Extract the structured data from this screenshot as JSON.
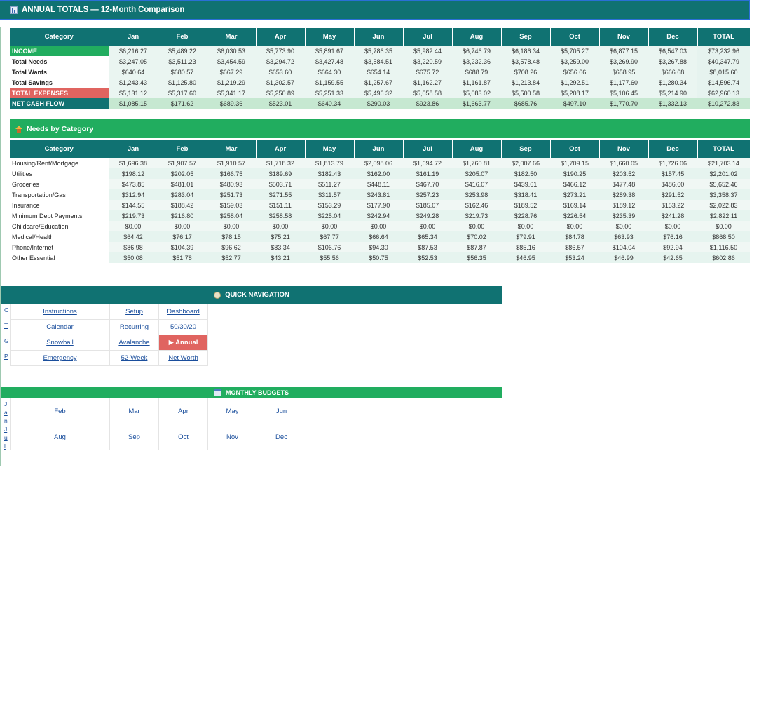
{
  "header": {
    "title": "ANNUAL TOTALS — 12-Month Comparison"
  },
  "months": [
    "Jan",
    "Feb",
    "Mar",
    "Apr",
    "May",
    "Jun",
    "Jul",
    "Aug",
    "Sep",
    "Oct",
    "Nov",
    "Dec"
  ],
  "summary": {
    "category_header": "Category",
    "total_header": "TOTAL",
    "rows": [
      {
        "label": "INCOME",
        "values": [
          "$6,216.27",
          "$5,489.22",
          "$6,030.53",
          "$5,773.90",
          "$5,891.67",
          "$5,786.35",
          "$5,982.44",
          "$6,746.79",
          "$6,186.34",
          "$5,705.27",
          "$6,877.15",
          "$6,547.03"
        ],
        "total": "$73,232.96"
      },
      {
        "label": "Total Needs",
        "values": [
          "$3,247.05",
          "$3,511.23",
          "$3,454.59",
          "$3,294.72",
          "$3,427.48",
          "$3,584.51",
          "$3,220.59",
          "$3,232.36",
          "$3,578.48",
          "$3,259.00",
          "$3,269.90",
          "$3,267.88"
        ],
        "total": "$40,347.79"
      },
      {
        "label": "Total Wants",
        "values": [
          "$640.64",
          "$680.57",
          "$667.29",
          "$653.60",
          "$664.30",
          "$654.14",
          "$675.72",
          "$688.79",
          "$708.26",
          "$656.66",
          "$658.95",
          "$666.68"
        ],
        "total": "$8,015.60"
      },
      {
        "label": "Total Savings",
        "values": [
          "$1,243.43",
          "$1,125.80",
          "$1,219.29",
          "$1,302.57",
          "$1,159.55",
          "$1,257.67",
          "$1,162.27",
          "$1,161.87",
          "$1,213.84",
          "$1,292.51",
          "$1,177.60",
          "$1,280.34"
        ],
        "total": "$14,596.74"
      },
      {
        "label": "TOTAL EXPENSES",
        "values": [
          "$5,131.12",
          "$5,317.60",
          "$5,341.17",
          "$5,250.89",
          "$5,251.33",
          "$5,496.32",
          "$5,058.58",
          "$5,083.02",
          "$5,500.58",
          "$5,208.17",
          "$5,106.45",
          "$5,214.90"
        ],
        "total": "$62,960.13"
      },
      {
        "label": "NET CASH FLOW",
        "values": [
          "$1,085.15",
          "$171.62",
          "$689.36",
          "$523.01",
          "$640.34",
          "$290.03",
          "$923.86",
          "$1,663.77",
          "$685.76",
          "$497.10",
          "$1,770.70",
          "$1,332.13"
        ],
        "total": "$10,272.83"
      }
    ]
  },
  "needs": {
    "section_title": "Needs by Category",
    "category_header": "Category",
    "total_header": "TOTAL",
    "rows": [
      {
        "label": "Housing/Rent/Mortgage",
        "values": [
          "$1,696.38",
          "$1,907.57",
          "$1,910.57",
          "$1,718.32",
          "$1,813.79",
          "$2,098.06",
          "$1,694.72",
          "$1,760.81",
          "$2,007.66",
          "$1,709.15",
          "$1,660.05",
          "$1,726.06"
        ],
        "total": "$21,703.14"
      },
      {
        "label": "Utilities",
        "values": [
          "$198.12",
          "$202.05",
          "$166.75",
          "$189.69",
          "$182.43",
          "$162.00",
          "$161.19",
          "$205.07",
          "$182.50",
          "$190.25",
          "$203.52",
          "$157.45"
        ],
        "total": "$2,201.02"
      },
      {
        "label": "Groceries",
        "values": [
          "$473.85",
          "$481.01",
          "$480.93",
          "$503.71",
          "$511.27",
          "$448.11",
          "$467.70",
          "$416.07",
          "$439.61",
          "$466.12",
          "$477.48",
          "$486.60"
        ],
        "total": "$5,652.46"
      },
      {
        "label": "Transportation/Gas",
        "values": [
          "$312.94",
          "$283.04",
          "$251.73",
          "$271.55",
          "$311.57",
          "$243.81",
          "$257.23",
          "$253.98",
          "$318.41",
          "$273.21",
          "$289.38",
          "$291.52"
        ],
        "total": "$3,358.37"
      },
      {
        "label": "Insurance",
        "values": [
          "$144.55",
          "$188.42",
          "$159.03",
          "$151.11",
          "$153.29",
          "$177.90",
          "$185.07",
          "$162.46",
          "$189.52",
          "$169.14",
          "$189.12",
          "$153.22"
        ],
        "total": "$2,022.83"
      },
      {
        "label": "Minimum Debt Payments",
        "values": [
          "$219.73",
          "$216.80",
          "$258.04",
          "$258.58",
          "$225.04",
          "$242.94",
          "$249.28",
          "$219.73",
          "$228.76",
          "$226.54",
          "$235.39",
          "$241.28"
        ],
        "total": "$2,822.11"
      },
      {
        "label": "Childcare/Education",
        "values": [
          "$0.00",
          "$0.00",
          "$0.00",
          "$0.00",
          "$0.00",
          "$0.00",
          "$0.00",
          "$0.00",
          "$0.00",
          "$0.00",
          "$0.00",
          "$0.00"
        ],
        "total": "$0.00"
      },
      {
        "label": "Medical/Health",
        "values": [
          "$64.42",
          "$76.17",
          "$78.15",
          "$75.21",
          "$67.77",
          "$66.64",
          "$65.34",
          "$70.02",
          "$79.91",
          "$84.78",
          "$63.93",
          "$76.16"
        ],
        "total": "$868.50"
      },
      {
        "label": "Phone/Internet",
        "values": [
          "$86.98",
          "$104.39",
          "$96.62",
          "$83.34",
          "$106.76",
          "$94.30",
          "$87.53",
          "$87.87",
          "$85.16",
          "$86.57",
          "$104.04",
          "$92.94"
        ],
        "total": "$1,116.50"
      },
      {
        "label": "Other Essential",
        "values": [
          "$50.08",
          "$51.78",
          "$52.77",
          "$43.21",
          "$55.56",
          "$50.75",
          "$52.53",
          "$56.35",
          "$46.95",
          "$53.24",
          "$46.99",
          "$42.65"
        ],
        "total": "$602.86"
      }
    ]
  },
  "quick_nav": {
    "title": "QUICK NAVIGATION",
    "rows": [
      [
        "Instructions",
        "Setup",
        "Dashboard"
      ],
      [
        "Calendar",
        "Recurring",
        "50/30/20"
      ],
      [
        "Snowball",
        "Avalanche",
        "▶ Annual"
      ],
      [
        "Emergency",
        "52-Week",
        "Net Worth"
      ]
    ],
    "left_column_glyphs": [
      "C",
      "T",
      "G",
      "P"
    ]
  },
  "monthly_budgets": {
    "title": "MONTHLY BUDGETS",
    "rows": [
      [
        "Feb",
        "Mar",
        "Apr",
        "May",
        "Jun"
      ],
      [
        "Aug",
        "Sep",
        "Oct",
        "Nov",
        "Dec"
      ]
    ],
    "left_column_glyphs": [
      "J",
      "a",
      "n",
      "J",
      "u",
      "l"
    ]
  }
}
